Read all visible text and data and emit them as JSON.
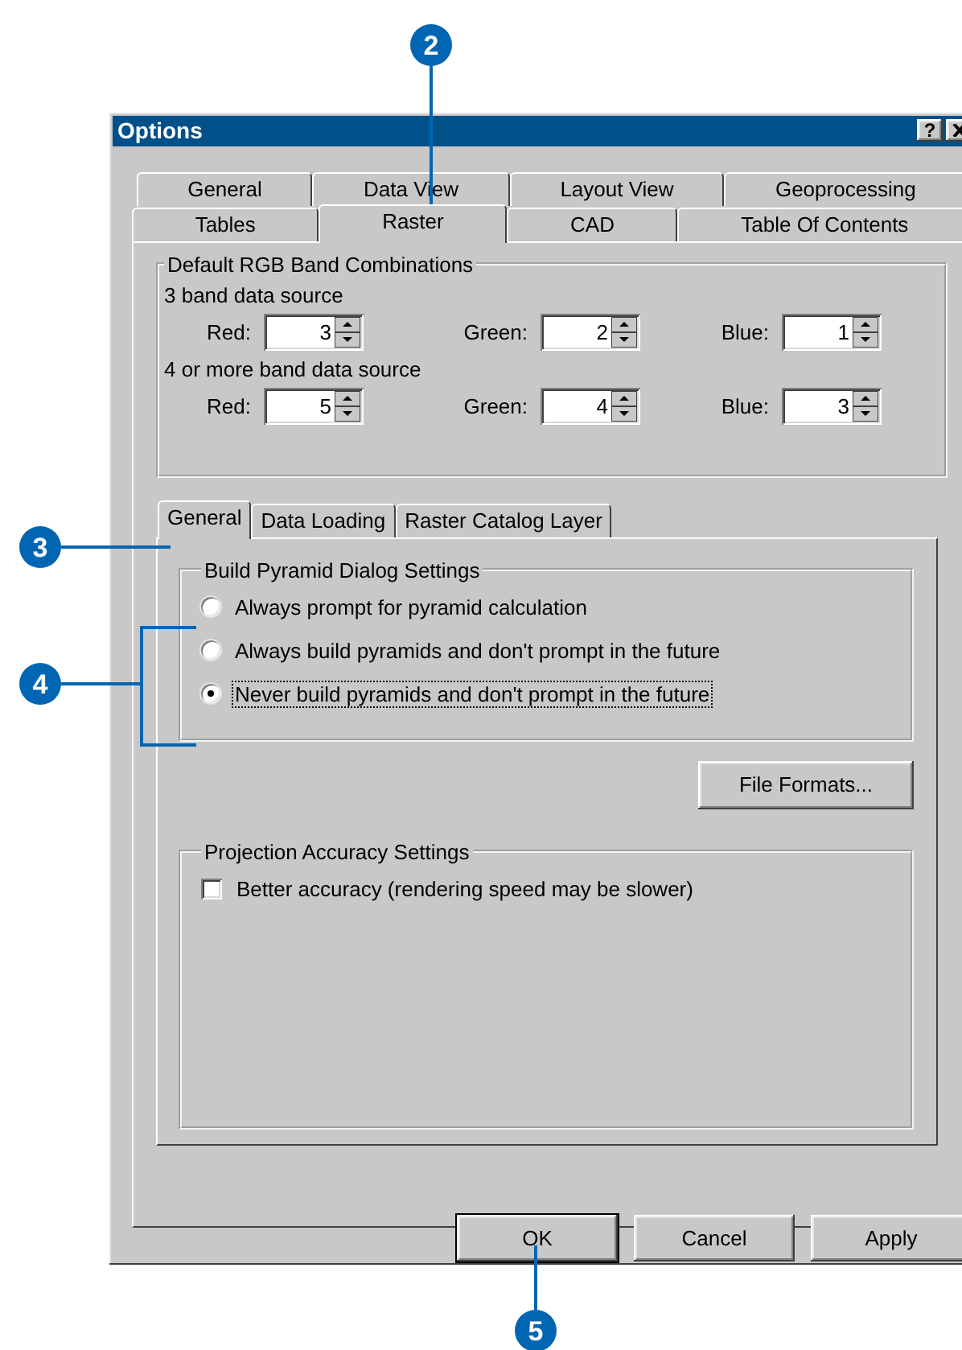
{
  "window": {
    "title": "Options",
    "help_button": "?"
  },
  "tab_rows": [
    [
      {
        "label": "General",
        "selected": false
      },
      {
        "label": "Data View",
        "selected": false
      },
      {
        "label": "Layout View",
        "selected": false
      },
      {
        "label": "Geoprocessing",
        "selected": false
      }
    ],
    [
      {
        "label": "Tables",
        "selected": false
      },
      {
        "label": "Raster",
        "selected": true
      },
      {
        "label": "CAD",
        "selected": false
      },
      {
        "label": "Table Of Contents",
        "selected": false
      }
    ]
  ],
  "band_group": {
    "title": "Default RGB Band Combinations",
    "sections": [
      {
        "label": "3 band data source",
        "fields": [
          {
            "label": "Red:",
            "value": "3"
          },
          {
            "label": "Green:",
            "value": "2"
          },
          {
            "label": "Blue:",
            "value": "1"
          }
        ]
      },
      {
        "label": "4 or more band data source",
        "fields": [
          {
            "label": "Red:",
            "value": "5"
          },
          {
            "label": "Green:",
            "value": "4"
          },
          {
            "label": "Blue:",
            "value": "3"
          }
        ]
      }
    ]
  },
  "sub_tabs": [
    {
      "label": "General",
      "selected": true
    },
    {
      "label": "Data Loading",
      "selected": false
    },
    {
      "label": "Raster Catalog Layer",
      "selected": false
    }
  ],
  "pyramid_group": {
    "title": "Build Pyramid Dialog Settings",
    "options": [
      {
        "label": "Always prompt for pyramid calculation",
        "selected": false,
        "focused": false
      },
      {
        "label": "Always build pyramids and don't prompt in the future",
        "selected": false,
        "focused": false
      },
      {
        "label": "Never build pyramids and don't prompt in the future",
        "selected": true,
        "focused": true
      }
    ]
  },
  "file_formats_button": "File Formats...",
  "projection_group": {
    "title": "Projection Accuracy Settings",
    "checkbox": {
      "label": "Better accuracy (rendering speed may be slower)",
      "checked": false
    }
  },
  "buttons": [
    {
      "label": "OK",
      "default": true
    },
    {
      "label": "Cancel",
      "default": false
    },
    {
      "label": "Apply",
      "default": false
    }
  ],
  "callouts": [
    {
      "number": "2"
    },
    {
      "number": "3"
    },
    {
      "number": "4"
    },
    {
      "number": "5"
    }
  ]
}
